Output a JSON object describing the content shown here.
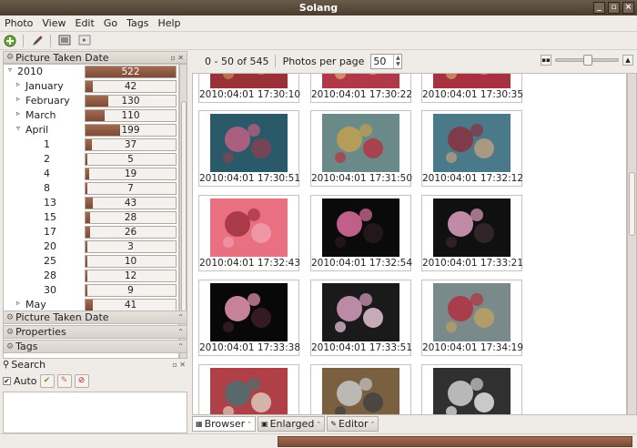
{
  "window": {
    "title": "Solang",
    "controls": [
      "_",
      "▫",
      "×"
    ]
  },
  "menu": [
    "Photo",
    "View",
    "Edit",
    "Go",
    "Tags",
    "Help"
  ],
  "toolbar_icons": [
    "add-icon",
    "edit-icon",
    "slideshow-icon",
    "export-icon"
  ],
  "sidebar": {
    "header": "Picture Taken Date",
    "tree": [
      {
        "label": "2010",
        "count": "522",
        "value": 522,
        "level": 0,
        "expander": "▿"
      },
      {
        "label": "January",
        "count": "42",
        "value": 42,
        "level": 1,
        "expander": "▹"
      },
      {
        "label": "February",
        "count": "130",
        "value": 130,
        "level": 1,
        "expander": "▹"
      },
      {
        "label": "March",
        "count": "110",
        "value": 110,
        "level": 1,
        "expander": "▹"
      },
      {
        "label": "April",
        "count": "199",
        "value": 199,
        "level": 1,
        "expander": "▿"
      },
      {
        "label": "1",
        "count": "37",
        "value": 37,
        "level": 2,
        "expander": ""
      },
      {
        "label": "2",
        "count": "5",
        "value": 5,
        "level": 2,
        "expander": ""
      },
      {
        "label": "4",
        "count": "19",
        "value": 19,
        "level": 2,
        "expander": ""
      },
      {
        "label": "8",
        "count": "7",
        "value": 7,
        "level": 2,
        "expander": ""
      },
      {
        "label": "13",
        "count": "43",
        "value": 43,
        "level": 2,
        "expander": ""
      },
      {
        "label": "15",
        "count": "28",
        "value": 28,
        "level": 2,
        "expander": ""
      },
      {
        "label": "17",
        "count": "26",
        "value": 26,
        "level": 2,
        "expander": ""
      },
      {
        "label": "20",
        "count": "3",
        "value": 3,
        "level": 2,
        "expander": ""
      },
      {
        "label": "25",
        "count": "10",
        "value": 10,
        "level": 2,
        "expander": ""
      },
      {
        "label": "28",
        "count": "12",
        "value": 12,
        "level": 2,
        "expander": ""
      },
      {
        "label": "30",
        "count": "9",
        "value": 9,
        "level": 2,
        "expander": ""
      },
      {
        "label": "May",
        "count": "41",
        "value": 41,
        "level": 1,
        "expander": "▹"
      }
    ],
    "max_value": 522,
    "collapsed_panels": [
      "Picture Taken Date",
      "Properties",
      "Tags"
    ]
  },
  "search": {
    "header": "Search",
    "auto_label": "Auto",
    "auto_checked": "✔"
  },
  "browser": {
    "counter": "0 - 50 of 545",
    "per_page_label": "Photos per page",
    "per_page_value": "50",
    "photos": [
      {
        "caption": "2010:04:01 17:30:10",
        "palette": [
          "#9a3038",
          "#5a2430",
          "#c89050"
        ]
      },
      {
        "caption": "2010:04:01 17:30:22",
        "palette": [
          "#b03848",
          "#3a2a2a",
          "#e0b070"
        ]
      },
      {
        "caption": "2010:04:01 17:30:35",
        "palette": [
          "#a83040",
          "#704848",
          "#d0a870"
        ]
      },
      {
        "caption": "2010:04:01 17:30:51",
        "palette": [
          "#2a5a6a",
          "#c06080",
          "#8a4050"
        ]
      },
      {
        "caption": "2010:04:01 17:31:50",
        "palette": [
          "#6a8a8a",
          "#c0a050",
          "#b83040"
        ]
      },
      {
        "caption": "2010:04:01 17:32:12",
        "palette": [
          "#4a7a8a",
          "#8a3040",
          "#c0a080"
        ]
      },
      {
        "caption": "2010:04:01 17:32:43",
        "palette": [
          "#e87080",
          "#a03040",
          "#f0a0b0"
        ]
      },
      {
        "caption": "2010:04:01 17:32:54",
        "palette": [
          "#0a0a0a",
          "#e070a0",
          "#2a1a20"
        ]
      },
      {
        "caption": "2010:04:01 17:33:21",
        "palette": [
          "#101010",
          "#e0a0c0",
          "#3a2a30"
        ]
      },
      {
        "caption": "2010:04:01 17:33:38",
        "palette": [
          "#080808",
          "#e898b0",
          "#402028"
        ]
      },
      {
        "caption": "2010:04:01 17:33:51",
        "palette": [
          "#1a1a1a",
          "#d8a0c0",
          "#f0d0e0"
        ]
      },
      {
        "caption": "2010:04:01 17:34:19",
        "palette": [
          "#7a8a8a",
          "#b03040",
          "#c0a060"
        ]
      },
      {
        "caption": "",
        "palette": [
          "#b04048",
          "#4a7070",
          "#e0d0c0"
        ]
      },
      {
        "caption": "",
        "palette": [
          "#7a6040",
          "#c8c8c8",
          "#404040"
        ]
      },
      {
        "caption": "",
        "palette": [
          "#303030",
          "#d0d0d0",
          "#f0f0f0"
        ]
      }
    ]
  },
  "tabs": [
    {
      "label": "Browser",
      "icon": "browser-icon",
      "active": true
    },
    {
      "label": "Enlarged",
      "icon": "enlarged-icon",
      "active": false
    },
    {
      "label": "Editor",
      "icon": "editor-icon",
      "active": false
    }
  ],
  "status": {
    "progress": 1.0
  }
}
